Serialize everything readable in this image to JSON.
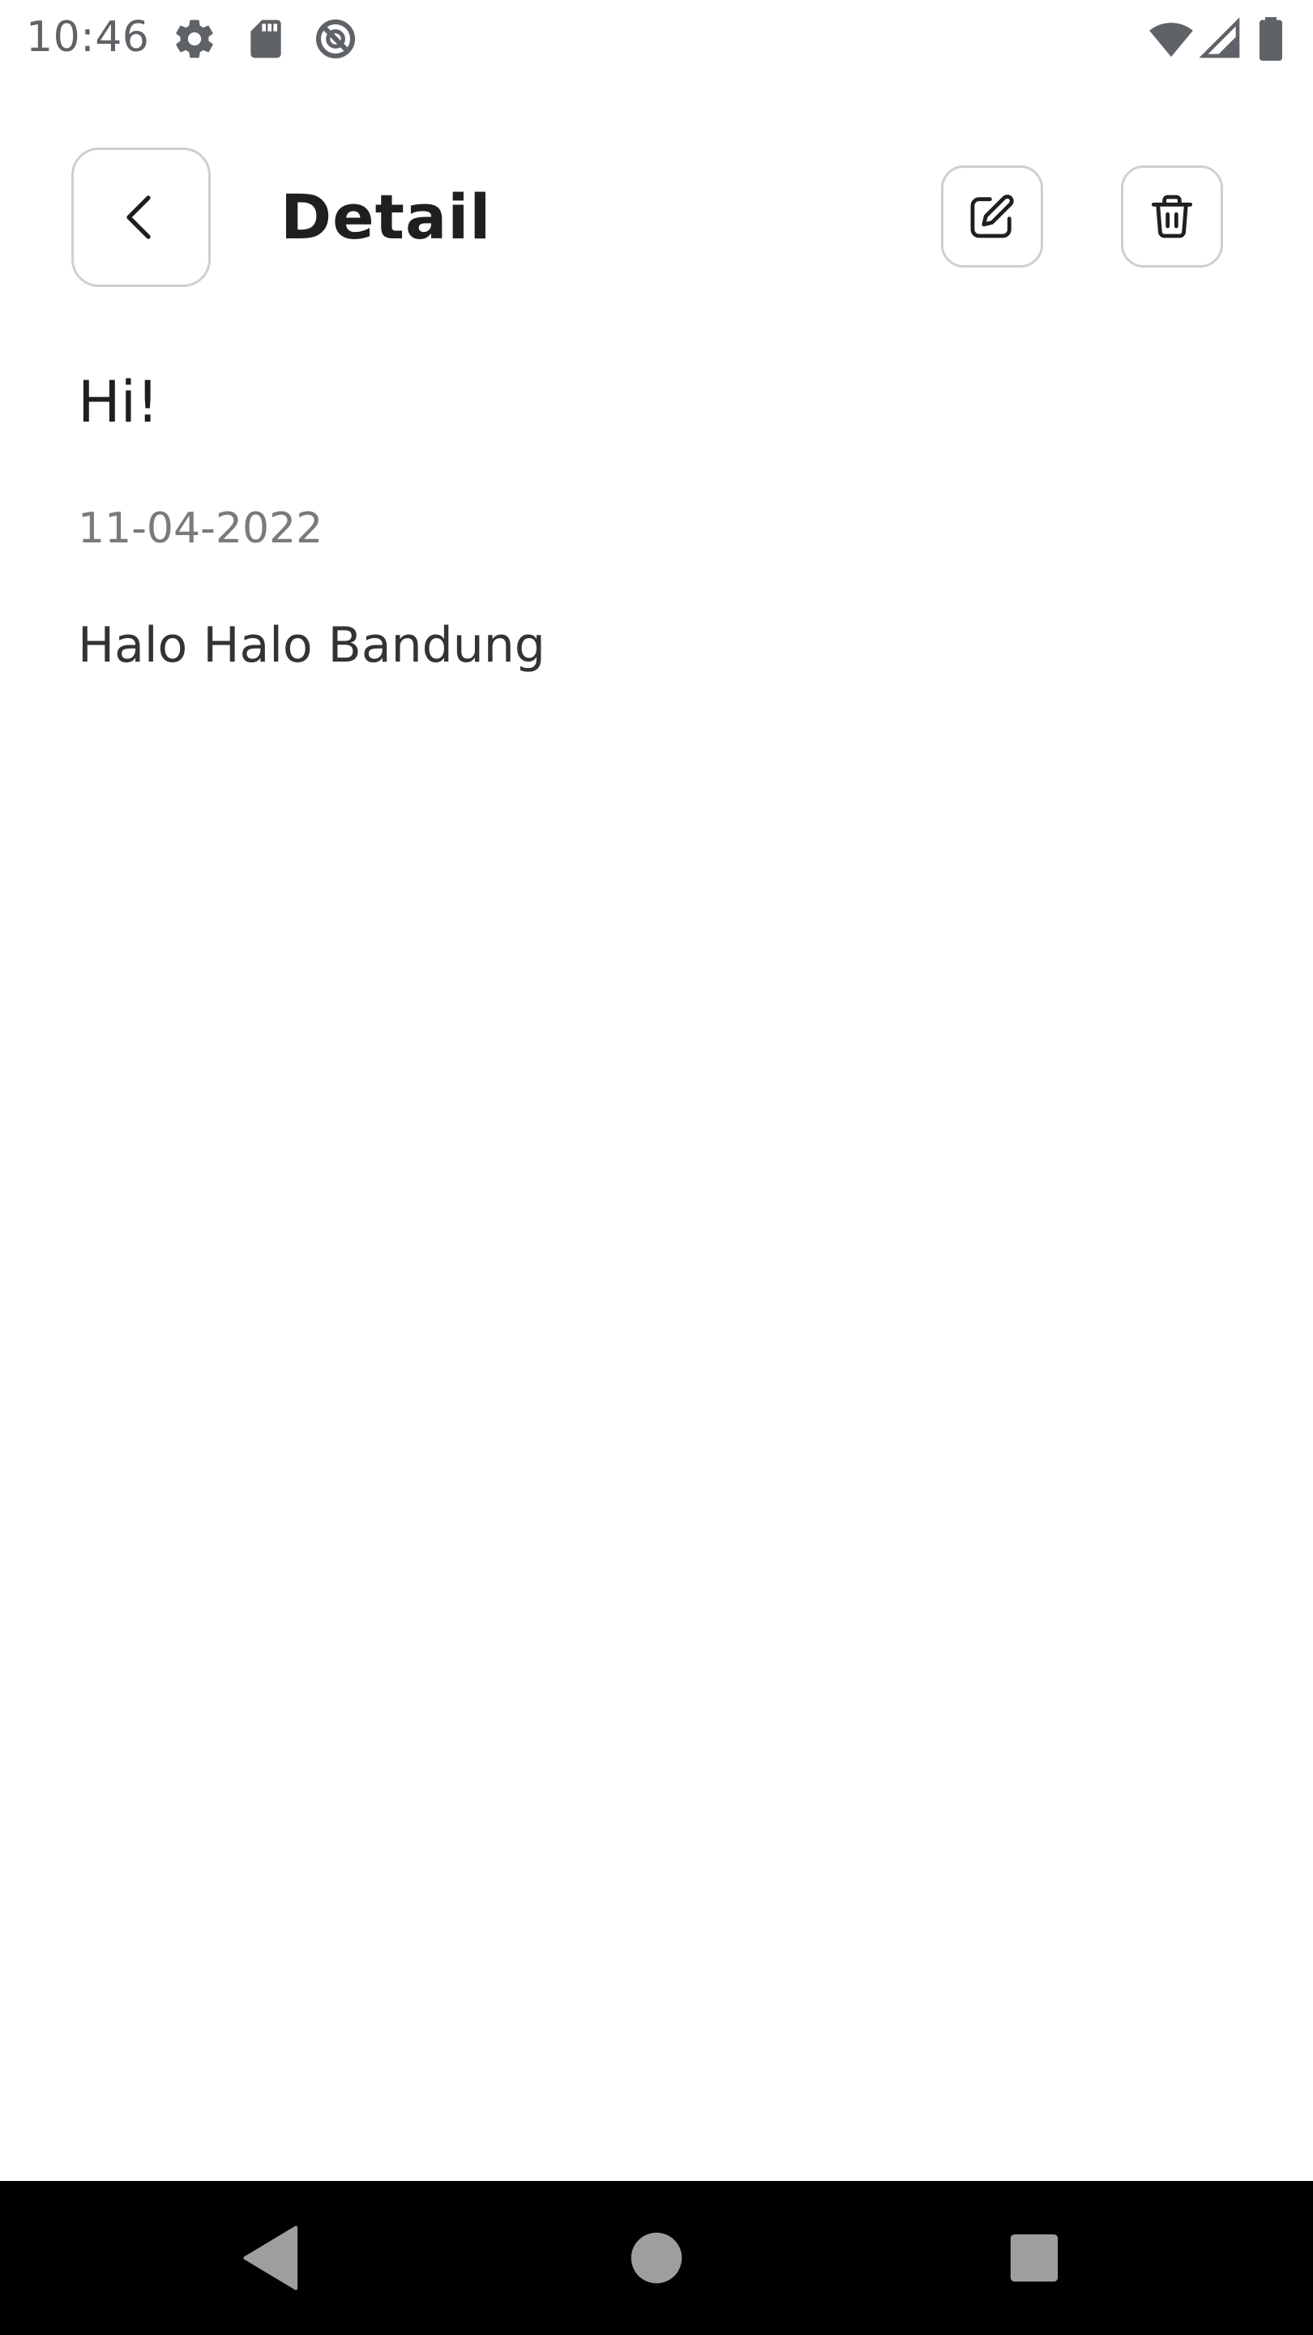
{
  "status_bar": {
    "time": "10:46",
    "left_icons": [
      "settings-icon",
      "sd-card-icon",
      "do-not-disturb-icon"
    ],
    "right_icons": [
      "wifi-icon",
      "cellular-signal-icon",
      "battery-icon"
    ]
  },
  "header": {
    "title": "Detail",
    "back_icon": "chevron-left-icon",
    "actions": [
      {
        "name": "edit",
        "icon": "edit-square-icon"
      },
      {
        "name": "delete",
        "icon": "trash-icon"
      }
    ]
  },
  "note": {
    "title": "Hi!",
    "date": "11-04-2022",
    "body": "Halo Halo Bandung"
  },
  "nav_bar": {
    "buttons": [
      "back-triangle-icon",
      "home-circle-icon",
      "recents-square-icon"
    ]
  },
  "colors": {
    "background": "#ffffff",
    "text_primary": "#1f1f1f",
    "text_secondary": "#7a7a7a",
    "border": "#cfcfcf",
    "status_icon": "#5f6368",
    "nav_bar_bg": "#000000",
    "nav_icon": "#9e9e9e"
  }
}
